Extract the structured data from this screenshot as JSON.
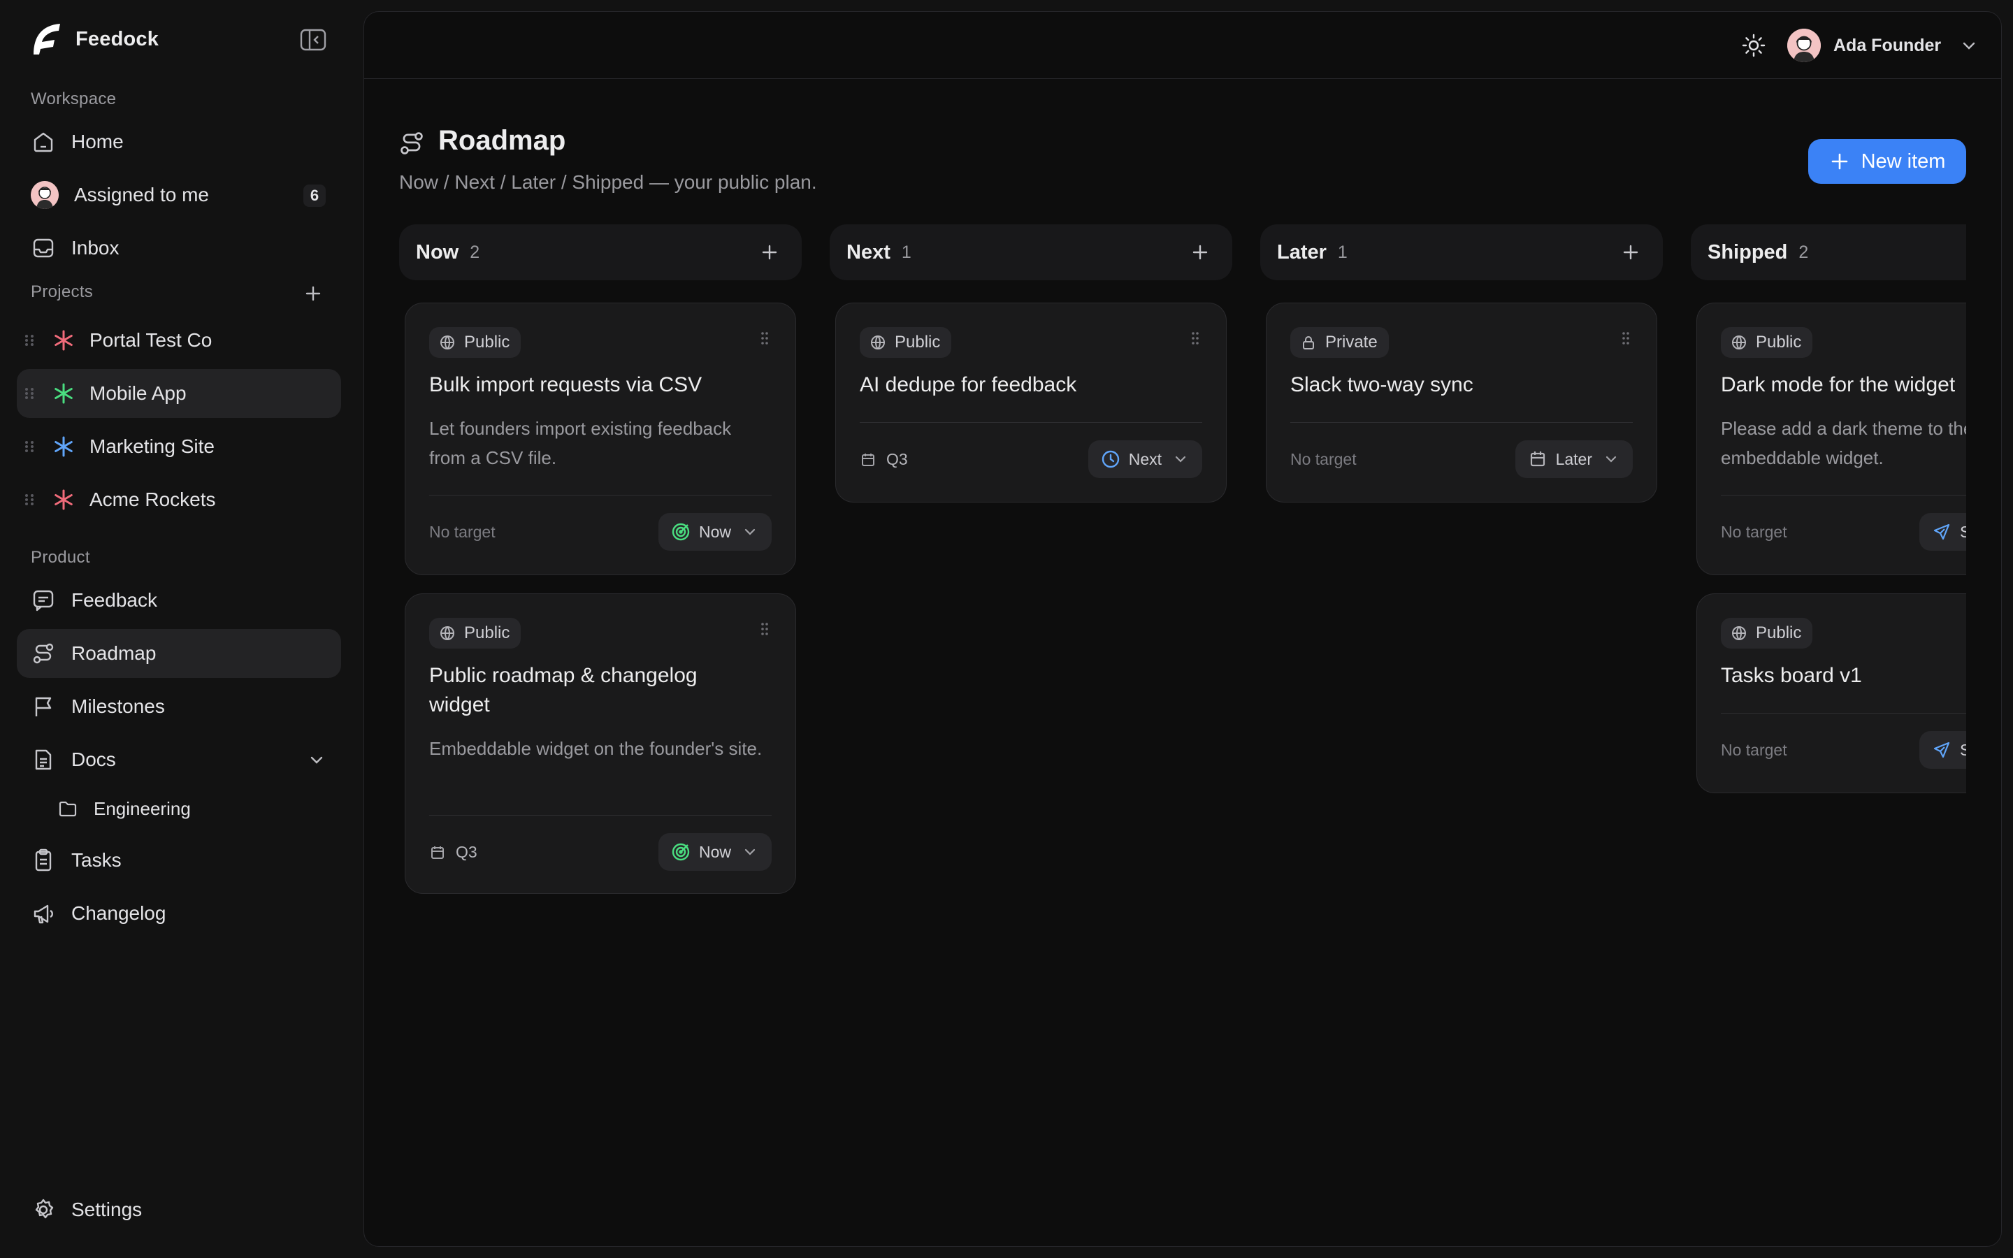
{
  "app": {
    "name": "Feedock"
  },
  "sidebar": {
    "workspace_label": "Workspace",
    "workspace_items": [
      {
        "label": "Home",
        "icon": "home-icon"
      },
      {
        "label": "Assigned to me",
        "icon": "avatar",
        "badge": "6"
      },
      {
        "label": "Inbox",
        "icon": "inbox-icon"
      }
    ],
    "projects_label": "Projects",
    "projects": [
      {
        "label": "Portal Test Co",
        "color": "#f06b7a"
      },
      {
        "label": "Mobile App",
        "color": "#4ade80",
        "active": true
      },
      {
        "label": "Marketing Site",
        "color": "#60a5fa"
      },
      {
        "label": "Acme Rockets",
        "color": "#f06b7a"
      }
    ],
    "product_label": "Product",
    "product_items": [
      {
        "label": "Feedback",
        "icon": "message-icon"
      },
      {
        "label": "Roadmap",
        "icon": "route-icon",
        "active": true
      },
      {
        "label": "Milestones",
        "icon": "flag-icon"
      },
      {
        "label": "Docs",
        "icon": "doc-icon"
      },
      {
        "label": "Engineering",
        "icon": "folder-icon"
      },
      {
        "label": "Tasks",
        "icon": "clipboard-icon"
      },
      {
        "label": "Changelog",
        "icon": "megaphone-icon"
      }
    ],
    "settings_label": "Settings"
  },
  "header": {
    "user_name": "Ada Founder"
  },
  "page": {
    "title": "Roadmap",
    "subtitle": "Now / Next / Later / Shipped — your public plan.",
    "new_button": "New item"
  },
  "columns": [
    {
      "name": "Now",
      "count": "2"
    },
    {
      "name": "Next",
      "count": "1"
    },
    {
      "name": "Later",
      "count": "1"
    },
    {
      "name": "Shipped",
      "count": "2"
    }
  ],
  "cards": {
    "now_1": {
      "visibility": "Public",
      "title": "Bulk import requests via CSV",
      "description": "Let founders import existing feedback from a CSV file.",
      "target": "No target",
      "status": "Now"
    },
    "now_2": {
      "visibility": "Public",
      "title": "Public roadmap & changelog widget",
      "description": "Embeddable widget on the founder's site.",
      "target": "Q3",
      "status": "Now"
    },
    "next_1": {
      "visibility": "Public",
      "title": "AI dedupe for feedback",
      "target": "Q3",
      "status": "Next"
    },
    "later_1": {
      "visibility": "Private",
      "title": "Slack two-way sync",
      "target": "No target",
      "status": "Later"
    },
    "shipped_1": {
      "visibility": "Public",
      "title": "Dark mode for the widget",
      "description": "Please add a dark theme to the embeddable widget.",
      "target": "No target",
      "status": "Shipped"
    },
    "shipped_2": {
      "visibility": "Public",
      "title": "Tasks board v1",
      "target": "No target",
      "status": "Shipped"
    }
  },
  "colors": {
    "accent": "#3b82f6",
    "now_status": "#4ade80",
    "next_status": "#60a5fa"
  }
}
